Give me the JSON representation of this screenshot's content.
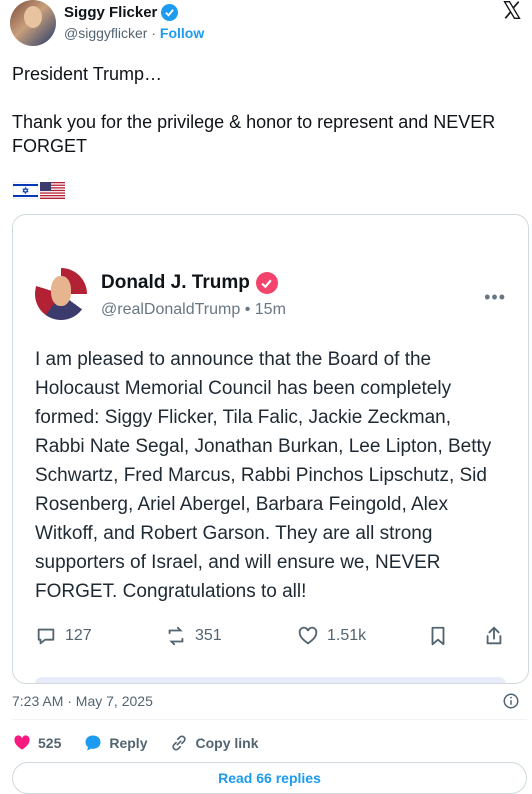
{
  "author": {
    "name": "Siggy Flicker",
    "handle": "@siggyflicker",
    "separator": "·",
    "follow_label": "Follow"
  },
  "tweet": {
    "text": "President Trump…\n\nThank you for the privilege & honor to represent and NEVER FORGET",
    "flags": [
      "israel-flag",
      "us-flag"
    ]
  },
  "quote": {
    "name": "Donald J. Trump",
    "handle": "@realDonaldTrump",
    "time": "• 15m",
    "more": "•••",
    "body": "I am pleased to announce that the Board of the Holocaust Memorial Council has been completely formed: Siggy Flicker, Tila Falic, Jackie Zeckman, Rabbi Nate Segal, Jonathan Burkan, Lee Lipton, Betty Schwartz, Fred Marcus, Rabbi Pinchos Lipschutz, Sid Rosenberg, Ariel Abergel, Barbara Feingold, Alex Witkoff, and Robert Garson. They are all strong supporters of Israel, and will ensure we, NEVER FORGET. Congratulations to all!",
    "actions": {
      "replies": "127",
      "reposts": "351",
      "likes": "1.51k"
    }
  },
  "meta": {
    "timestamp": "7:23 AM · May 7, 2025"
  },
  "engagement": {
    "likes": "525",
    "reply_label": "Reply",
    "copy_label": "Copy link"
  },
  "footer": {
    "read_replies": "Read 66 replies"
  },
  "colors": {
    "accent": "#1d9bf0",
    "like": "#f91880",
    "truth_badge": "#f4436c"
  }
}
